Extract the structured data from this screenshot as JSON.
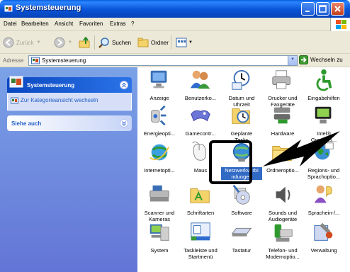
{
  "window": {
    "title": "Systemsteuerung"
  },
  "menubar": [
    "Datei",
    "Bearbeiten",
    "Ansicht",
    "Favoriten",
    "Extras",
    "?"
  ],
  "toolbar": {
    "back": "Zurück",
    "search": "Suchen",
    "folders": "Ordner"
  },
  "address": {
    "label": "Adresse",
    "value": "Systemsteuerung",
    "go": "Wechseln zu"
  },
  "sidebar": {
    "panel1": {
      "title": "Systemsteuerung",
      "link": "Zur Kategorieansicht wechseln"
    },
    "panel2": {
      "title": "Siehe auch"
    }
  },
  "items": [
    {
      "name": "Anzeige",
      "icon": "display-icon"
    },
    {
      "name": "Benutzerko...",
      "icon": "user-accounts-icon"
    },
    {
      "name": "Datum und\nUhrzeit",
      "icon": "date-time-icon"
    },
    {
      "name": "Drucker und\nFaxgeräte",
      "icon": "printer-icon"
    },
    {
      "name": "Eingabehilfen",
      "icon": "accessibility-icon"
    },
    {
      "name": "Energieopti...",
      "icon": "power-options-icon"
    },
    {
      "name": "Gamecontr...",
      "icon": "game-controller-icon"
    },
    {
      "name": "Geplante\nTasks",
      "icon": "scheduled-tasks-icon"
    },
    {
      "name": "Hardware",
      "icon": "hardware-icon"
    },
    {
      "name": "Intel®\nGraphics...",
      "icon": "intel-graphics-icon"
    },
    {
      "name": "Internetopti...",
      "icon": "internet-options-icon"
    },
    {
      "name": "Maus",
      "icon": "mouse-icon"
    },
    {
      "name": "Netzwerkverbi\nndungen",
      "icon": "network-connections-icon",
      "selected": true
    },
    {
      "name": "Ordneroptio...",
      "icon": "folder-options-icon"
    },
    {
      "name": "Regions- und\nSprachoptio...",
      "icon": "regional-options-icon"
    },
    {
      "name": "Scanner und\nKameras",
      "icon": "scanner-icon"
    },
    {
      "name": "Schriftarten",
      "icon": "fonts-icon"
    },
    {
      "name": "Software",
      "icon": "software-icon"
    },
    {
      "name": "Sounds und\nAudiogeräte",
      "icon": "sound-icon"
    },
    {
      "name": "Sprachein-/...",
      "icon": "speech-icon"
    },
    {
      "name": "System",
      "icon": "system-icon"
    },
    {
      "name": "Taskleiste und\nStartmenü",
      "icon": "taskbar-icon"
    },
    {
      "name": "Tastatur",
      "icon": "keyboard-icon"
    },
    {
      "name": "Telefon- und\nModemoptio...",
      "icon": "phone-modem-icon"
    },
    {
      "name": "Verwaltung",
      "icon": "admin-tools-icon"
    }
  ]
}
